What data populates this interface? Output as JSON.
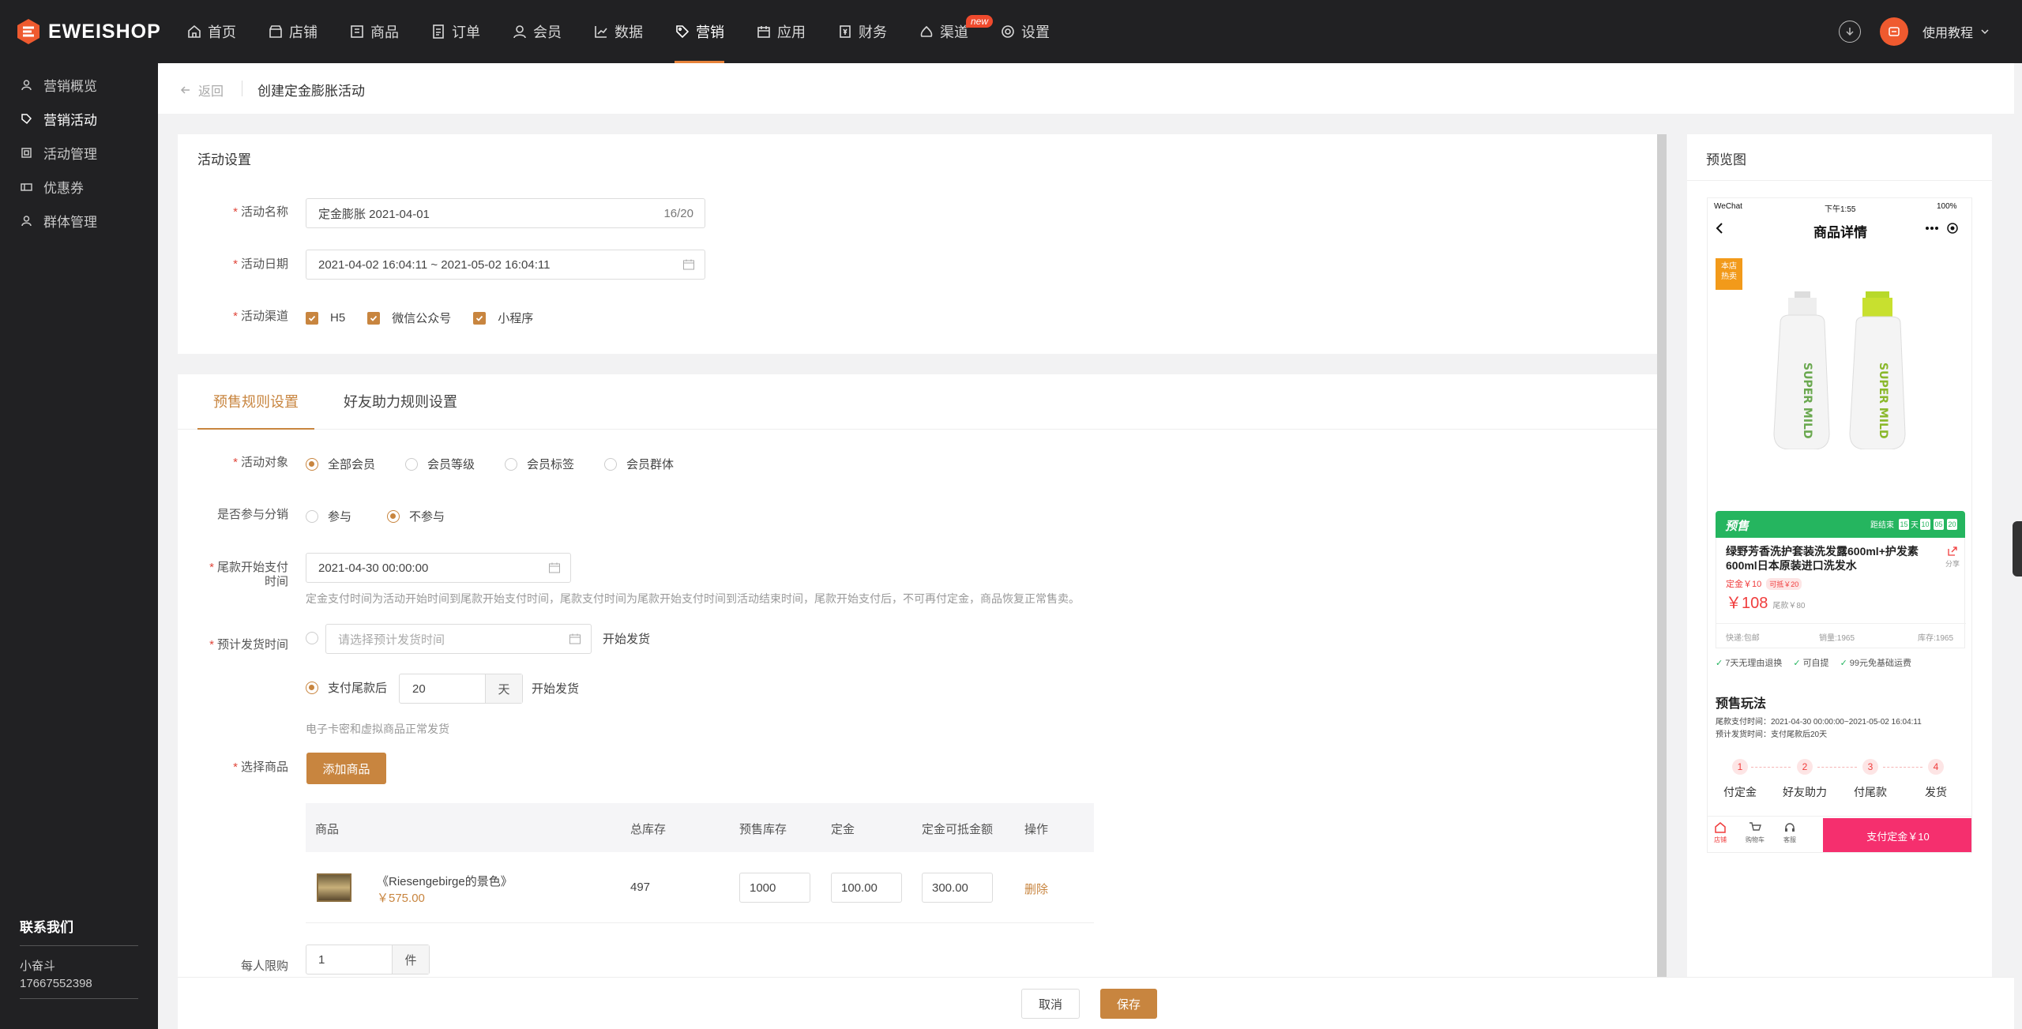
{
  "brand": {
    "name": "EWEISHOP",
    "accent": "#c8853f"
  },
  "nav": {
    "items": [
      {
        "label": "首页",
        "icon": "home-icon"
      },
      {
        "label": "店铺",
        "icon": "shop-icon"
      },
      {
        "label": "商品",
        "icon": "goods-icon"
      },
      {
        "label": "订单",
        "icon": "order-icon"
      },
      {
        "label": "会员",
        "icon": "member-icon"
      },
      {
        "label": "数据",
        "icon": "chart-icon"
      },
      {
        "label": "营销",
        "icon": "tag-icon"
      },
      {
        "label": "应用",
        "icon": "app-icon"
      },
      {
        "label": "财务",
        "icon": "finance-icon"
      },
      {
        "label": "渠道",
        "icon": "channel-icon"
      },
      {
        "label": "设置",
        "icon": "gear-icon"
      }
    ],
    "active": "营销",
    "new_badge": "new",
    "help": "使用教程"
  },
  "sidebar": {
    "items": [
      {
        "label": "营销概览"
      },
      {
        "label": "营销活动"
      },
      {
        "label": "活动管理"
      },
      {
        "label": "优惠券"
      },
      {
        "label": "群体管理"
      }
    ],
    "contact_title": "联系我们",
    "contact_name": "小奋斗",
    "contact_phone": "17667552398"
  },
  "header": {
    "back": "返回",
    "title": "创建定金膨胀活动"
  },
  "activity": {
    "section_title": "活动设置",
    "name_label": "活动名称",
    "name_value": "定金膨胀  2021-04-01",
    "name_count": "16/20",
    "date_label": "活动日期",
    "date_value": "2021-04-02 16:04:11  ~  2021-05-02 16:04:11",
    "channel_label": "活动渠道",
    "channels": [
      "H5",
      "微信公众号",
      "小程序"
    ]
  },
  "tabs": [
    "预售规则设置",
    "好友助力规则设置"
  ],
  "rules": {
    "target_label": "活动对象",
    "targets": [
      "全部会员",
      "会员等级",
      "会员标签",
      "会员群体"
    ],
    "dist_label": "是否参与分销",
    "dist_options": [
      "参与",
      "不参与"
    ],
    "final_label_1": "尾款开始支付",
    "final_label_2": "时间",
    "final_value": "2021-04-30 00:00:00",
    "final_hint": "定金支付时间为活动开始时间到尾款开始支付时间，尾款支付时间为尾款开始支付时间到活动结束时间，尾款开始支付后，不可再付定金，商品恢复正常售卖。",
    "ship_label": "预计发货时间",
    "ship_placeholder": "请选择预计发货时间",
    "ship_suffix": "开始发货",
    "after_pay_label": "支付尾款后",
    "after_pay_days": "20",
    "days_unit": "天",
    "after_pay_suffix": "开始发货",
    "ship_hint": "电子卡密和虚拟商品正常发货",
    "goods_label": "选择商品",
    "add_goods": "添加商品",
    "limit_label": "每人限购",
    "limit_value": "1",
    "limit_unit": "件"
  },
  "table": {
    "headers": [
      "商品",
      "总库存",
      "预售库存",
      "定金",
      "定金可抵金额",
      "操作"
    ],
    "rows": [
      {
        "name": "《Riesengebirge的景色》",
        "price": "￥575.00",
        "stock": "497",
        "presale_stock": "1000",
        "deposit": "100.00",
        "deduct": "300.00",
        "action": "删除"
      }
    ]
  },
  "footer": {
    "cancel": "取消",
    "save": "保存"
  },
  "preview": {
    "title": "预览图",
    "status_left": "WeChat",
    "status_time": "下午1:55",
    "status_battery": "100%",
    "page_title": "商品详情",
    "hot_tag_1": "本店",
    "hot_tag_2": "热卖",
    "bottle_text": "SUPER MILD",
    "presale_label": "预售",
    "countdown_label": "距结束",
    "countdown_day": "15",
    "countdown_day_unit": "天",
    "countdown": [
      "10",
      "05",
      "20"
    ],
    "product_name": "绿野芳香洗护套装洗发露600ml+护发素600ml日本原装进口洗发水",
    "share": "分享",
    "deposit": "定金￥10",
    "deduct": "可抵￥20",
    "price": "￥108",
    "final_price": "尾款￥80",
    "shipping": "快递:包邮",
    "sales": "销量:1965",
    "stock": "库存:1965",
    "guarantees": [
      "7天无理由退换",
      "可自提",
      "99元免基础运费"
    ],
    "play_title": "预售玩法",
    "final_time": "尾款支付时间：2021-04-30 00:00:00~2021-05-02 16:04:11",
    "ship_time": "预计发货时间：支付尾款后20天",
    "steps": [
      "付定金",
      "好友助力",
      "付尾款",
      "发货"
    ],
    "bottom_icons": [
      "店铺",
      "购物车",
      "客服"
    ],
    "pay_button": "支付定金￥10"
  }
}
